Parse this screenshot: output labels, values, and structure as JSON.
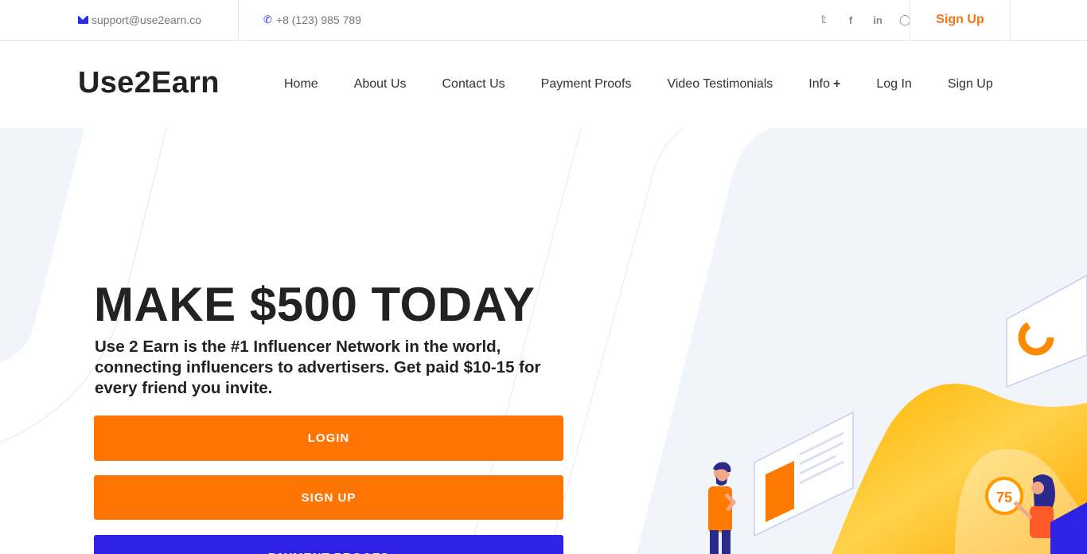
{
  "topbar": {
    "email": "support@use2earn.co",
    "phone": "+8 (123) 985 789",
    "social": [
      "twitter-icon",
      "facebook-icon",
      "linkedin-icon",
      "instagram-icon"
    ],
    "signup_label": "Sign Up"
  },
  "header": {
    "logo": "Use2Earn",
    "nav": [
      "Home",
      "About Us",
      "Contact Us",
      "Payment Proofs",
      "Video Testimonials",
      "Info",
      "Log In",
      "Sign Up"
    ]
  },
  "hero": {
    "headline": "MAKE $500 TODAY",
    "subtext": "Use 2 Earn is the #1 Influencer Network in the world, connecting influencers to advertisers. Get paid $10-15 for every friend you invite.",
    "buttons": {
      "login": "LOGIN",
      "signup": "SIGN UP",
      "proofs": "PAYMENT PROOFS"
    },
    "illustration_badge": "75"
  },
  "colors": {
    "accent_orange": "#ff7504",
    "accent_blue": "#2f22e6",
    "signup_orange": "#f57416"
  }
}
